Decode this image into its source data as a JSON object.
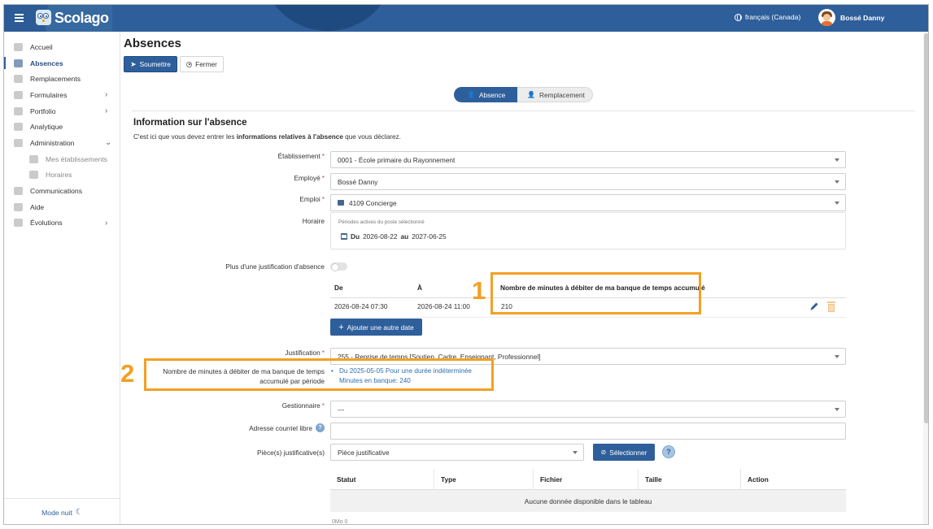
{
  "app": {
    "brand": "Scolago"
  },
  "topbar": {
    "language": "français (Canada)",
    "user": "Bossé Danny"
  },
  "sidebar": {
    "items": [
      {
        "label": "Accueil",
        "icon": "home-icon"
      },
      {
        "label": "Absences",
        "icon": "absence-icon",
        "active": true
      },
      {
        "label": "Remplacements",
        "icon": "replacement-icon"
      },
      {
        "label": "Formulaires",
        "icon": "form-icon",
        "chevron": "›"
      },
      {
        "label": "Portfolio",
        "icon": "trophy-icon",
        "chevron": "›"
      },
      {
        "label": "Analytique",
        "icon": "analytics-icon"
      },
      {
        "label": "Administration",
        "icon": "gear-icon",
        "chevron": "⌄"
      },
      {
        "label": "Mes établissements",
        "icon": "building-icon",
        "sub": true
      },
      {
        "label": "Horaires",
        "icon": "calendar-icon",
        "sub": true
      },
      {
        "label": "Communications",
        "icon": "megaphone-icon"
      },
      {
        "label": "Aide",
        "icon": "question-icon"
      },
      {
        "label": "Évolutions",
        "icon": "sprout-icon",
        "chevron": "›"
      }
    ],
    "night_mode": "Mode nuit"
  },
  "page": {
    "title": "Absences",
    "submit_label": "Soumettre",
    "close_label": "Fermer",
    "steps": {
      "absence": "Absence",
      "replacement": "Remplacement"
    },
    "section_title": "Information sur l'absence",
    "section_desc_pre": "C'est ici que vous devez entrer les ",
    "section_desc_bold": "informations relatives à l'absence",
    "section_desc_post": " que vous déclarez."
  },
  "form": {
    "etablissement_label": "Établissement",
    "etablissement_value": "0001 - École primaire du Rayonnement",
    "employe_label": "Employé",
    "employe_value": "Bossé Danny",
    "emploi_label": "Emploi",
    "emploi_value": "4109 Concierge",
    "horaire_label": "Horaire",
    "horaire_caption": "Périodes actives du poste sélectionné",
    "horaire_du": "Du",
    "horaire_from": "2026-08-22",
    "horaire_au": "au",
    "horaire_to": "2027-06-25",
    "multi_justif_label": "Plus d'une justification d'absence",
    "dates_table": {
      "col_from": "De",
      "col_to": "À",
      "col_minutes": "Nombre de minutes à débiter de ma banque de temps accumulé",
      "rows": [
        {
          "from": "2026-08-24 07:30",
          "to": "2026-08-24 11:00",
          "minutes": "210"
        }
      ]
    },
    "add_date_label": "Ajouter une autre date",
    "justification_label": "Justification",
    "justification_value": "255 - Reprise de temps [Soutien, Cadre, Enseignant, Professionnel]",
    "bank_label_line1": "Nombre de minutes à débiter de ma banque de temps",
    "bank_label_line2": "accumulé par période",
    "bank_period": "Du 2025-05-05 Pour une durée indéterminée",
    "bank_minutes": "Minutes en banque: 240",
    "gestionnaire_label": "Gestionnaire",
    "gestionnaire_value": "---",
    "email_label": "Adresse courriel libre",
    "email_value": "",
    "pieces_label": "Pièce(s) justificative(s)",
    "piece_value": "Pièce justificative",
    "select_label": "Sélectionner",
    "files_table": {
      "columns": [
        "Statut",
        "Type",
        "Fichier",
        "Taille",
        "Action"
      ],
      "empty": "Aucune donnée disponible dans le tableau"
    },
    "footer_partial": "0Mo   0"
  },
  "annotations": {
    "one": "1",
    "two": "2",
    "color": "#f2a023"
  },
  "colors": {
    "primary": "#2e5f9b",
    "required": "#d24b4b",
    "link": "#2e6fad"
  }
}
